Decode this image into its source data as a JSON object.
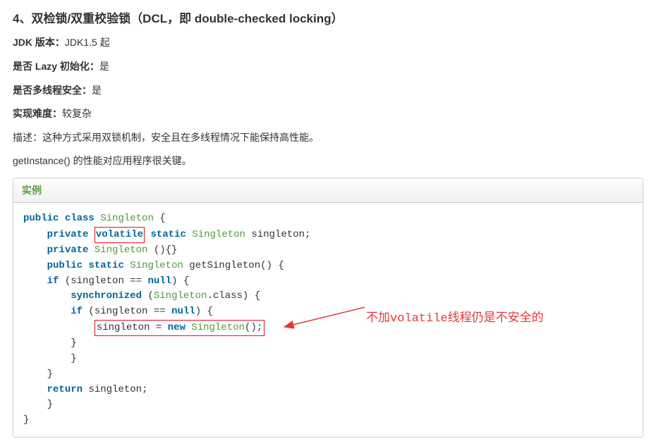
{
  "heading": "4、双检锁/双重校验锁（DCL，即 double-checked locking）",
  "meta": {
    "jdk_label": "JDK 版本：",
    "jdk_value": "JDK1.5 起",
    "lazy_label": "是否 Lazy 初始化：",
    "lazy_value": "是",
    "thread_label": "是否多线程安全：",
    "thread_value": "是",
    "difficulty_label": "实现难度：",
    "difficulty_value": "较复杂"
  },
  "desc_label": "描述：",
  "desc_text": "这种方式采用双锁机制，安全且在多线程情况下能保持高性能。",
  "note_text": "getInstance() 的性能对应用程序很关键。",
  "example_header": "实例",
  "code": {
    "kw_public": "public",
    "kw_class": "class",
    "kw_private": "private",
    "kw_volatile": "volatile",
    "kw_static": "static",
    "kw_if": "if",
    "kw_null": "null",
    "kw_synchronized": "synchronized",
    "kw_new": "new",
    "kw_return": "return",
    "cls_Singleton": "Singleton",
    "id_singleton": "singleton",
    "fn_getSingleton": "getSingleton",
    "dot_class": ".class"
  },
  "annotation_text_before": "不加",
  "annotation_code": "volatile",
  "annotation_text_after": "线程仍是不安全的"
}
